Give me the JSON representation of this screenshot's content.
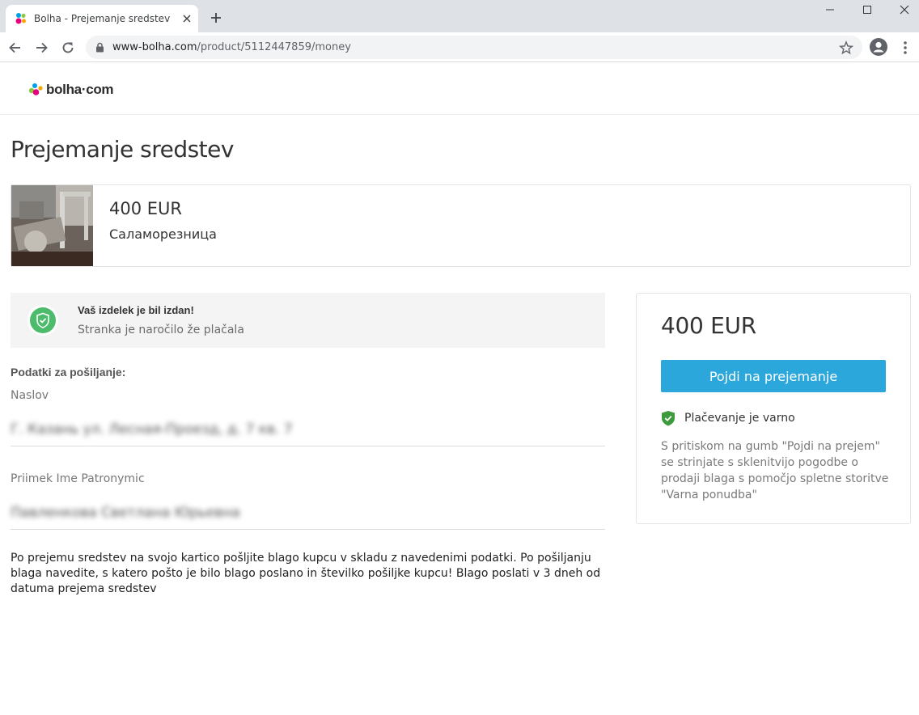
{
  "browser": {
    "tab_title": "Bolha - Prejemanje sredstev",
    "url_domain": "www-bolha.com",
    "url_path": "/product/5112447859/money"
  },
  "site": {
    "logo_text": "bolha·com",
    "brand_colors": [
      "#e6007e",
      "#00a0e3",
      "#8dc63f",
      "#f7a600"
    ]
  },
  "page": {
    "title": "Prejemanje sredstev"
  },
  "product": {
    "price": "400 EUR",
    "name": "Саламорезница"
  },
  "notice": {
    "title": "Vaš izdelek je bil izdan!",
    "subtitle": "Stranka je naročilo že plačala",
    "icon": "shield-check-icon",
    "icon_color": "#4cbb6c"
  },
  "shipping": {
    "section_label": "Podatki za pošiljanje:",
    "address_label": "Naslov",
    "address_value": "Г. Казань ул. Лесная-Проезд, д. 7 кв. 7",
    "name_label": "Priimek Ime Patronymic",
    "name_value": "Павленкова Светлана Юрьевна"
  },
  "instructions": "Po prejemu sredstev na svojo kartico pošljite blago kupcu v skladu z navedenimi podatki. Po pošiljanju blaga navedite, s katero pošto je bilo blago poslano in številko pošiljke kupcu! Blago poslati v 3 dneh od datuma prejema sredstev",
  "side_panel": {
    "price": "400 EUR",
    "button_label": "Pojdi na prejemanje",
    "button_color": "#2ba7dc",
    "secure_text": "Plačevanje je varno",
    "secure_icon_color": "#3d9a3d",
    "legal_text": "S pritiskom na gumb \"Pojdi na prejem\" se strinjate s sklenitvijo pogodbe o prodaji blaga s pomočjo spletne storitve \"Varna ponudba\""
  }
}
